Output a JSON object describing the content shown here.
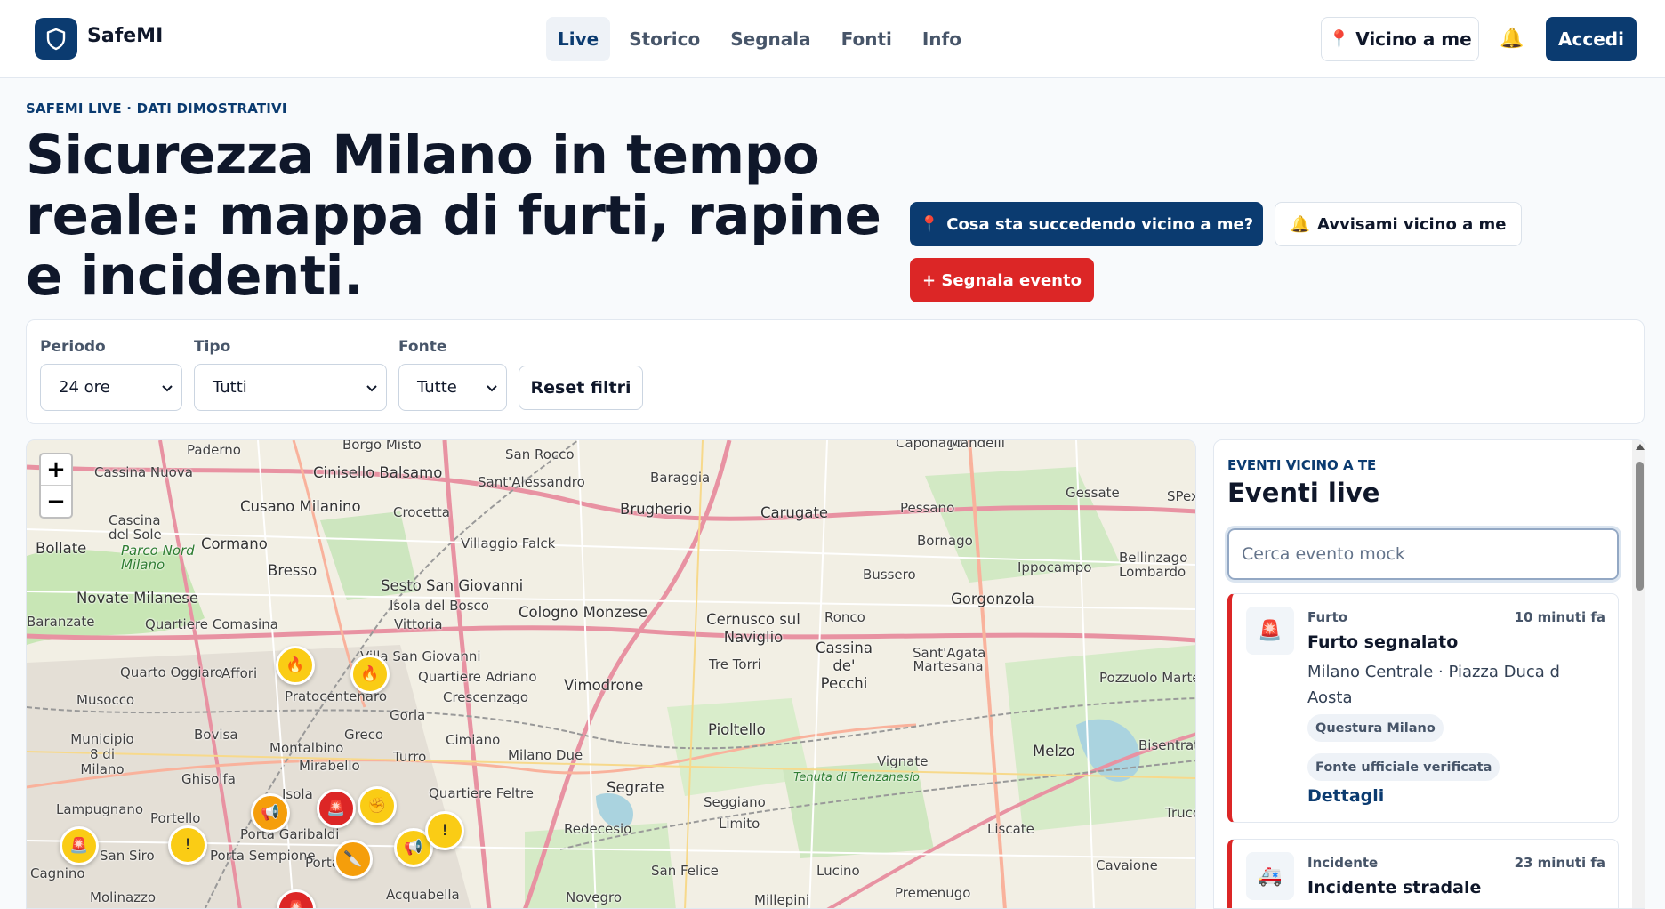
{
  "app": {
    "brand": "SafeMI"
  },
  "nav": {
    "items": [
      {
        "label": "Live",
        "active": true
      },
      {
        "label": "Storico",
        "active": false
      },
      {
        "label": "Segnala",
        "active": false
      },
      {
        "label": "Fonti",
        "active": false
      },
      {
        "label": "Info",
        "active": false
      }
    ]
  },
  "header": {
    "near_label": "Vicino a me",
    "login_label": "Accedi"
  },
  "hero": {
    "eyebrow": "SAFEMI LIVE · DATI DIMOSTRATIVI",
    "title": "Sicurezza Milano in tempo reale: mappa di furti, rapine e incidenti.",
    "cta_primary": "Cosa sta succedendo vicino a me?",
    "cta_secondary": "Avvisami vicino a me",
    "cta_report": "+ Segnala evento"
  },
  "filters": {
    "period": {
      "label": "Periodo",
      "value": "24 ore"
    },
    "type": {
      "label": "Tipo",
      "value": "Tutti"
    },
    "source": {
      "label": "Fonte",
      "value": "Tutte"
    },
    "reset_label": "Reset filtri"
  },
  "map": {
    "zoom_in": "+",
    "zoom_out": "−",
    "places": [
      "Paderno",
      "Borgo Misto",
      "San Rocco",
      "Caponago",
      "Mandelli",
      "Cassina Nuova",
      "Cinisello Balsamo",
      "Sant'Alessandro",
      "Baraggia",
      "Cusano Milanino",
      "Crocetta",
      "Brugherio",
      "Carugate",
      "Pessano",
      "Gessate",
      "SPex",
      "Cascina del Sole",
      "Bollate",
      "Parco Nord Milano",
      "Cormano",
      "Villaggio Falck",
      "Bornago",
      "Bresso",
      "Bussero",
      "Ippocampo",
      "Bellinzago Lombardo",
      "Novate Milanese",
      "Sesto San Giovanni",
      "Isola del Bosco",
      "Gorgonzola",
      "Baranzate",
      "Quartiere Comasina",
      "Vittoria",
      "Cologno Monzese",
      "Cernusco sul Naviglio",
      "Ronco",
      "Villa San Giovanni",
      "Cassina de' Pecchi",
      "Sant'Agata Martesana",
      "Quarto Oggiaro",
      "Affori",
      "Quartiere Adriano",
      "Tre Torri",
      "Pozzuolo Martesana",
      "Musocco",
      "Pratocentenaro",
      "Crescenzago",
      "Vimodrone",
      "Gorla",
      "Bovisa",
      "Greco",
      "Municipio 8 di Milano",
      "Cimiano",
      "Pioltello",
      "Bisentrate",
      "Montalbino",
      "Mirabello",
      "Turro",
      "Milano Due",
      "Melzo",
      "Ghisolfa",
      "Vignate",
      "Tenuta di Trenzanesio",
      "Isola",
      "Segrate",
      "Lampugnano",
      "Quartiere Feltre",
      "Seggiano",
      "Portello",
      "Porta Garibaldi",
      "Redecesio",
      "Limito",
      "Liscate",
      "Trucca",
      "San Siro",
      "Porta Sempione",
      "Porta",
      "Cagnino",
      "San Felice",
      "Lucino",
      "Cavaione",
      "Molinazzo",
      "Acquabella",
      "Novegro",
      "Millepini",
      "Premenugo"
    ],
    "markers": [
      {
        "icon": "🔥",
        "color": "#facc15"
      },
      {
        "icon": "🔥",
        "color": "#facc15"
      },
      {
        "icon": "📢",
        "color": "#f59e0b"
      },
      {
        "icon": "🚨",
        "color": "#dc2626"
      },
      {
        "icon": "✊",
        "color": "#facc15"
      },
      {
        "icon": "🚨",
        "color": "#facc15"
      },
      {
        "icon": "!",
        "color": "#facc15"
      },
      {
        "icon": "📢",
        "color": "#facc15"
      },
      {
        "icon": "!",
        "color": "#facc15"
      },
      {
        "icon": "🔪",
        "color": "#f59e0b"
      },
      {
        "icon": "🚨",
        "color": "#dc2626"
      }
    ]
  },
  "panel": {
    "eyebrow": "EVENTI VICINO A TE",
    "title": "Eventi live",
    "search_placeholder": "Cerca evento mock",
    "events": [
      {
        "icon": "🚨",
        "category": "Furto",
        "time": "10 minuti fa",
        "title": "Furto segnalato",
        "location": "Milano Centrale · Piazza Duca d Aosta",
        "source": "Questura Milano",
        "verification": "Fonte ufficiale verificata",
        "link": "Dettagli"
      },
      {
        "icon": "🚑",
        "category": "Incidente",
        "time": "23 minuti fa",
        "title": "Incidente stradale"
      }
    ]
  },
  "colors": {
    "primary": "#0b3b70",
    "danger": "#dc2626",
    "marker_yellow": "#facc15",
    "marker_orange": "#f59e0b"
  }
}
